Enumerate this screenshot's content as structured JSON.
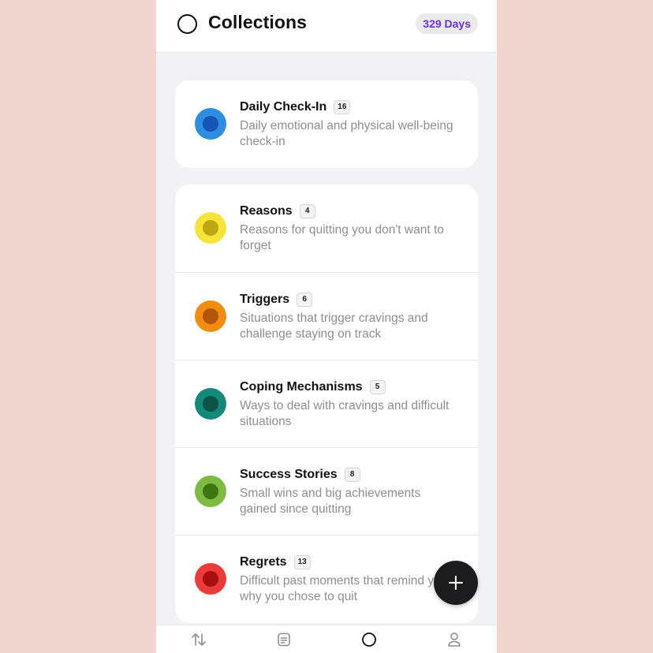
{
  "header": {
    "title": "Collections",
    "days_badge": "329 Days"
  },
  "featured": {
    "title": "Daily Check-In",
    "count": "16",
    "description": "Daily emotional and physical well-being check-in",
    "color": "#2F8DE0",
    "color_inner": "#1456B8"
  },
  "collections": [
    {
      "title": "Reasons",
      "count": "4",
      "description": "Reasons for quitting you don't want to forget",
      "color": "#F7E43A",
      "color_inner": "#BBA810"
    },
    {
      "title": "Triggers",
      "count": "6",
      "description": "Situations that trigger cravings and challenge staying on track",
      "color": "#F28C12",
      "color_inner": "#B4550C"
    },
    {
      "title": "Coping Mechanisms",
      "count": "5",
      "description": "Ways to deal with cravings and difficult situations",
      "color": "#13897A",
      "color_inner": "#0B5247"
    },
    {
      "title": "Success Stories",
      "count": "8",
      "description": "Small wins and big achievements gained since quitting",
      "color": "#7DBB42",
      "color_inner": "#3E7512"
    },
    {
      "title": "Regrets",
      "count": "13",
      "description": "Difficult past moments that remind you why you chose to quit",
      "color": "#EB3B3B",
      "color_inner": "#A80E0E"
    }
  ],
  "tabbar": {
    "items": [
      {
        "icon": "swap-arrows-icon"
      },
      {
        "icon": "journal-icon"
      },
      {
        "icon": "collections-ring-icon"
      },
      {
        "icon": "profile-icon"
      }
    ]
  }
}
